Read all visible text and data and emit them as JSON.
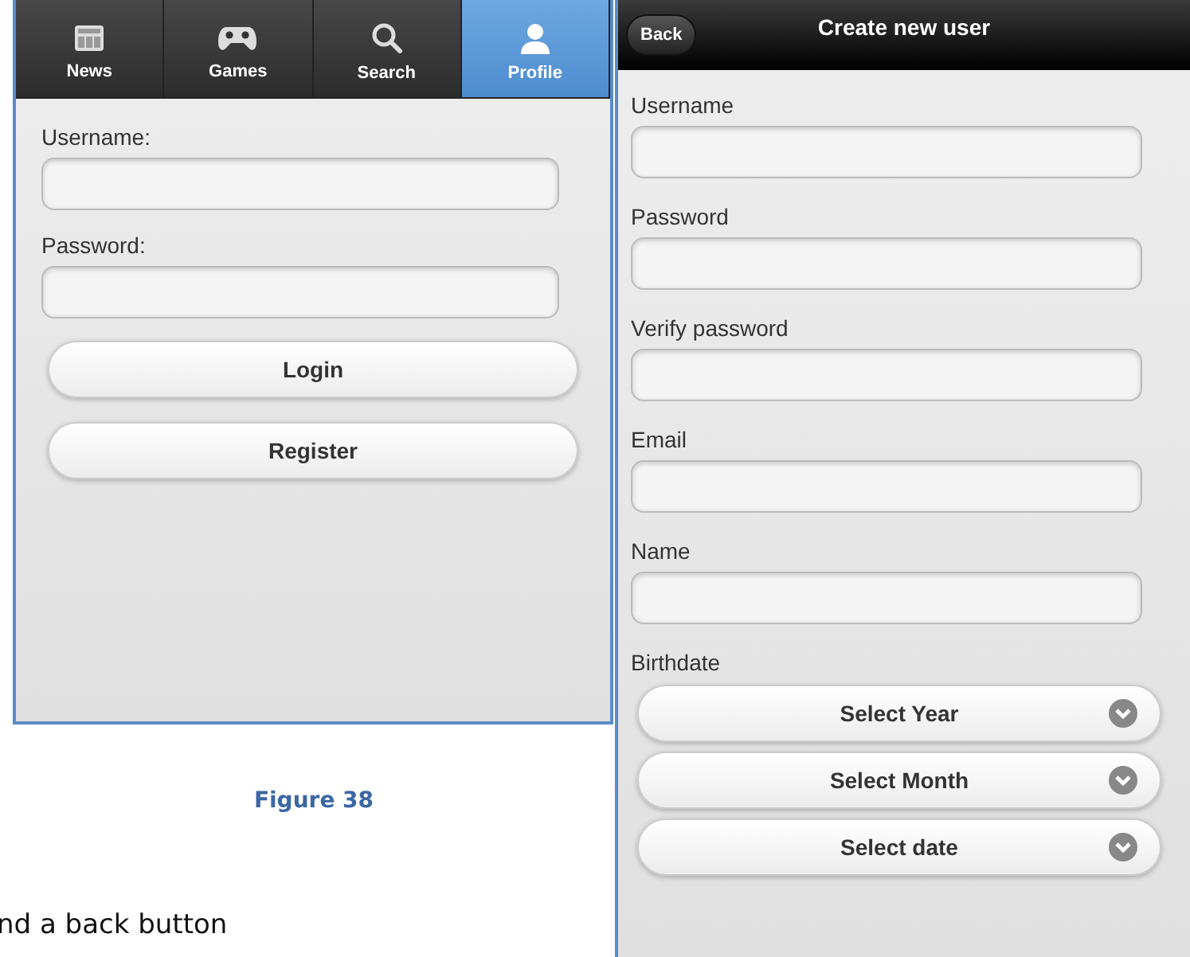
{
  "login_screen": {
    "tabs": [
      {
        "label": "News",
        "selected": false
      },
      {
        "label": "Games",
        "selected": false
      },
      {
        "label": "Search",
        "selected": false
      },
      {
        "label": "Profile",
        "selected": true
      }
    ],
    "fields": [
      {
        "label": "Username:"
      },
      {
        "label": "Password:"
      }
    ],
    "buttons": [
      "Login",
      "Register"
    ]
  },
  "caption": "Figure 38",
  "body_text": "nd a back button",
  "register_screen": {
    "back_button": "Back",
    "title": "Create new user",
    "fields": [
      {
        "label": "Username"
      },
      {
        "label": "Password"
      },
      {
        "label": "Verify password"
      },
      {
        "label": "Email"
      },
      {
        "label": "Name"
      }
    ],
    "birthdate_label": "Birthdate",
    "selects": [
      "Select Year",
      "Select Month",
      "Select date"
    ]
  }
}
